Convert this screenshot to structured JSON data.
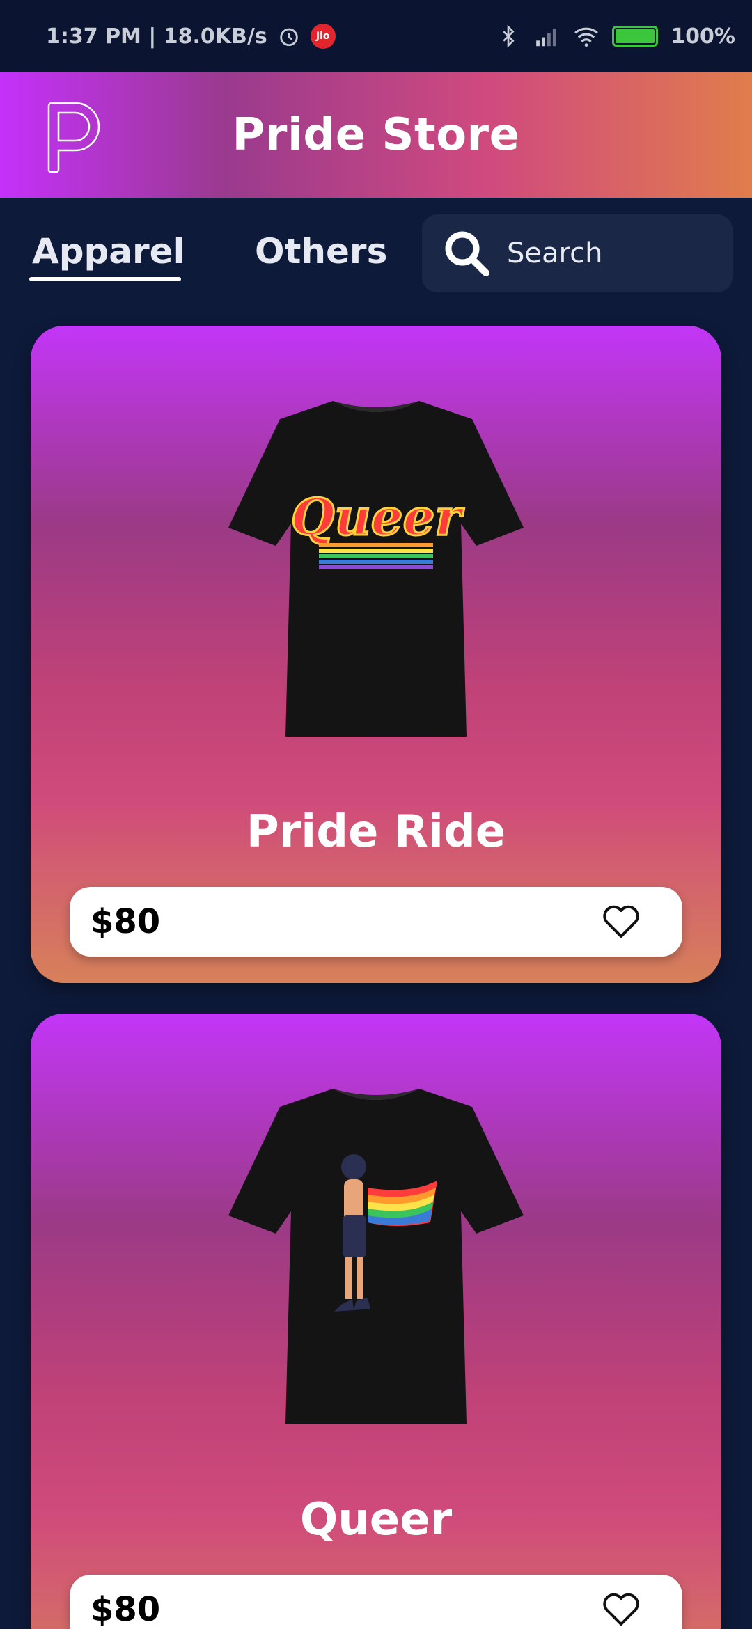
{
  "status_bar": {
    "time_speed": "1:37 PM | 18.0KB/s",
    "carrier_badge": "Jio",
    "battery": "100%",
    "battery_level": 1.0
  },
  "header": {
    "title": "Pride Store",
    "logo_icon": "p-logo-icon"
  },
  "tabs": [
    {
      "label": "Apparel",
      "active": true
    },
    {
      "label": "Others",
      "active": false
    }
  ],
  "search": {
    "placeholder": "Search"
  },
  "products": [
    {
      "name": "Pride Ride",
      "price": "$80",
      "print_text": "Queer",
      "favorite_icon": "heart-outline-icon"
    },
    {
      "name": "Queer",
      "price": "$80",
      "print_text": "",
      "favorite_icon": "heart-outline-icon"
    }
  ],
  "colors": {
    "background": "#0e1a3a",
    "header_gradient_start": "#c431fb",
    "header_gradient_end": "#e07d4c",
    "card_gradient_top": "#c236f7",
    "card_gradient_bottom": "#d7815a",
    "search_bg": "#1b2746"
  }
}
